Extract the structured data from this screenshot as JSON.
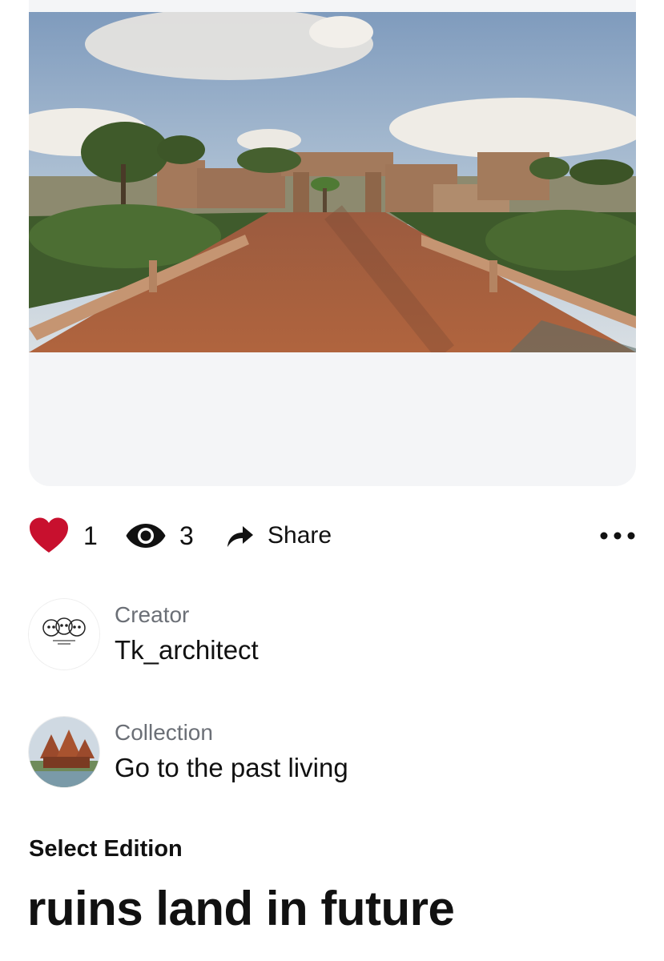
{
  "artwork": {
    "alt": "Render of a wooden boardwalk leading through gardens to brick ruins"
  },
  "stats": {
    "likes": "1",
    "views": "3",
    "share_label": "Share",
    "like_icon": "heart-icon",
    "view_icon": "eye-icon",
    "share_icon": "share-arrow-icon",
    "more_icon": "more-dots-icon",
    "like_color": "#c8102e"
  },
  "creator": {
    "label": "Creator",
    "name": "Tk_architect"
  },
  "collection": {
    "label": "Collection",
    "name": "Go to the past living"
  },
  "edition": {
    "label": "Select Edition"
  },
  "nft": {
    "title": "ruins land in future"
  }
}
